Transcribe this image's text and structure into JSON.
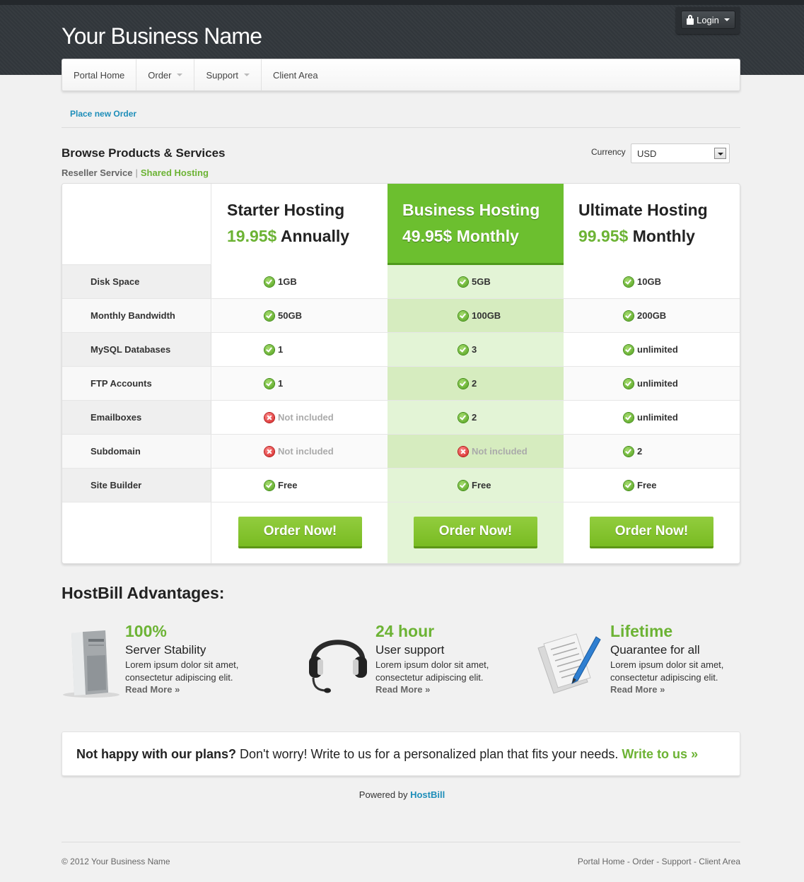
{
  "header": {
    "brand": "Your Business Name",
    "login_label": "Login"
  },
  "nav": {
    "items": [
      {
        "label": "Portal Home",
        "dropdown": false
      },
      {
        "label": "Order",
        "dropdown": true
      },
      {
        "label": "Support",
        "dropdown": true
      },
      {
        "label": "Client Area",
        "dropdown": false
      }
    ]
  },
  "breadcrumb": "Place new Order",
  "browse": {
    "title": "Browse Products & Services",
    "categories": [
      "Reseller Service",
      "Shared Hosting"
    ],
    "active_category": "Shared Hosting",
    "currency_label": "Currency",
    "currency_value": "USD"
  },
  "plans": [
    {
      "name": "Starter Hosting",
      "amount": "19.95$",
      "cycle": "Annually",
      "featured": false,
      "order_label": "Order Now!"
    },
    {
      "name": "Business Hosting",
      "amount": "49.95$",
      "cycle": "Monthly",
      "featured": true,
      "order_label": "Order Now!"
    },
    {
      "name": "Ultimate Hosting",
      "amount": "99.95$",
      "cycle": "Monthly",
      "featured": false,
      "order_label": "Order Now!"
    }
  ],
  "features": [
    {
      "label": "Disk Space",
      "values": [
        {
          "text": "1GB",
          "ok": true
        },
        {
          "text": "5GB",
          "ok": true
        },
        {
          "text": "10GB",
          "ok": true
        }
      ]
    },
    {
      "label": "Monthly Bandwidth",
      "values": [
        {
          "text": "50GB",
          "ok": true
        },
        {
          "text": "100GB",
          "ok": true
        },
        {
          "text": "200GB",
          "ok": true
        }
      ]
    },
    {
      "label": "MySQL Databases",
      "values": [
        {
          "text": "1",
          "ok": true
        },
        {
          "text": "3",
          "ok": true
        },
        {
          "text": "unlimited",
          "ok": true
        }
      ]
    },
    {
      "label": "FTP Accounts",
      "values": [
        {
          "text": "1",
          "ok": true
        },
        {
          "text": "2",
          "ok": true
        },
        {
          "text": "unlimited",
          "ok": true
        }
      ]
    },
    {
      "label": "Emailboxes",
      "values": [
        {
          "text": "Not included",
          "ok": false
        },
        {
          "text": "2",
          "ok": true
        },
        {
          "text": "unlimited",
          "ok": true
        }
      ]
    },
    {
      "label": "Subdomain",
      "values": [
        {
          "text": "Not included",
          "ok": false
        },
        {
          "text": "Not included",
          "ok": false
        },
        {
          "text": "2",
          "ok": true
        }
      ]
    },
    {
      "label": "Site Builder",
      "values": [
        {
          "text": "Free",
          "ok": true
        },
        {
          "text": "Free",
          "ok": true
        },
        {
          "text": "Free",
          "ok": true
        }
      ]
    }
  ],
  "advantages": {
    "title": "HostBill Advantages:",
    "items": [
      {
        "icon": "server-icon",
        "headline": "100%",
        "subline": "Server Stability",
        "desc": "Lorem ipsum dolor sit amet, consectetur adipiscing elit.",
        "more": "Read More »"
      },
      {
        "icon": "headset-icon",
        "headline": "24 hour",
        "subline": "User support",
        "desc": "Lorem ipsum dolor sit amet, consectetur adipiscing elit.",
        "more": "Read More »"
      },
      {
        "icon": "documents-pen-icon",
        "headline": "Lifetime",
        "subline": "Quarantee for all",
        "desc": "Lorem ipsum dolor sit amet, consectetur adipiscing elit.",
        "more": "Read More »"
      }
    ]
  },
  "banner": {
    "bold": "Not happy with our plans?",
    "text": "Don't worry! Write to us for a personalized plan that fits your needs.",
    "link": "Write to us »"
  },
  "powered": {
    "prefix": "Powered by",
    "brand": "HostBill"
  },
  "footer": {
    "copyright": "© 2012 Your Business Name",
    "links": [
      "Portal Home",
      "Order",
      "Support",
      "Client Area"
    ],
    "separator": " - "
  },
  "colors": {
    "accent_green": "#6cb334",
    "featured_green": "#6cbf2f",
    "link_blue": "#1e8eb9",
    "header_dark": "#32373c"
  }
}
